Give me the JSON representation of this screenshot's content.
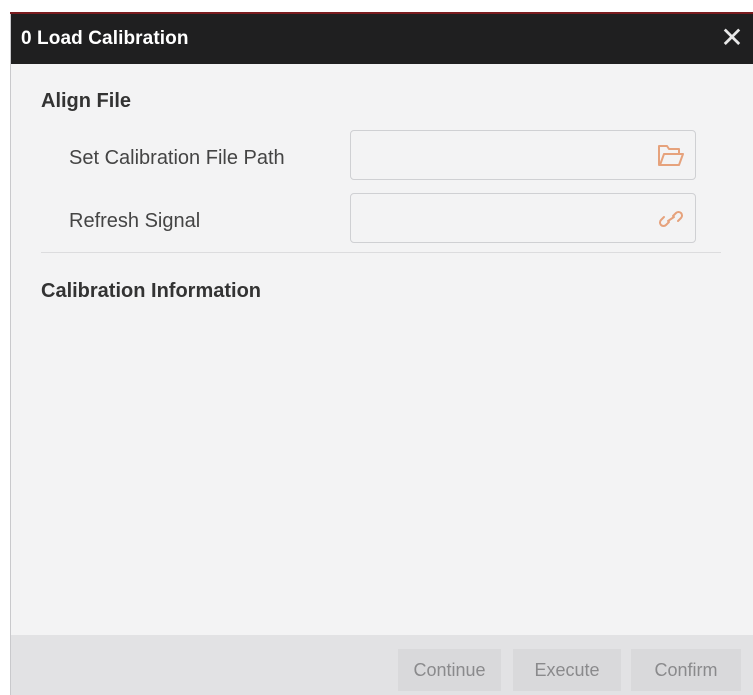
{
  "dialog": {
    "title": "0 Load Calibration",
    "close_glyph": "✕"
  },
  "align_file": {
    "heading": "Align File",
    "calibration_path": {
      "label": "Set Calibration File Path",
      "value": "",
      "icon": "folder-open-icon"
    },
    "refresh_signal": {
      "label": "Refresh Signal",
      "value": "",
      "icon": "link-icon"
    }
  },
  "calibration_info": {
    "heading": "Calibration Information"
  },
  "footer": {
    "continue_label": "Continue",
    "execute_label": "Execute",
    "confirm_label": "Confirm"
  },
  "colors": {
    "titlebar": "#1f1f20",
    "accent": "#7a1c1f",
    "icon": "#e6a27c"
  }
}
